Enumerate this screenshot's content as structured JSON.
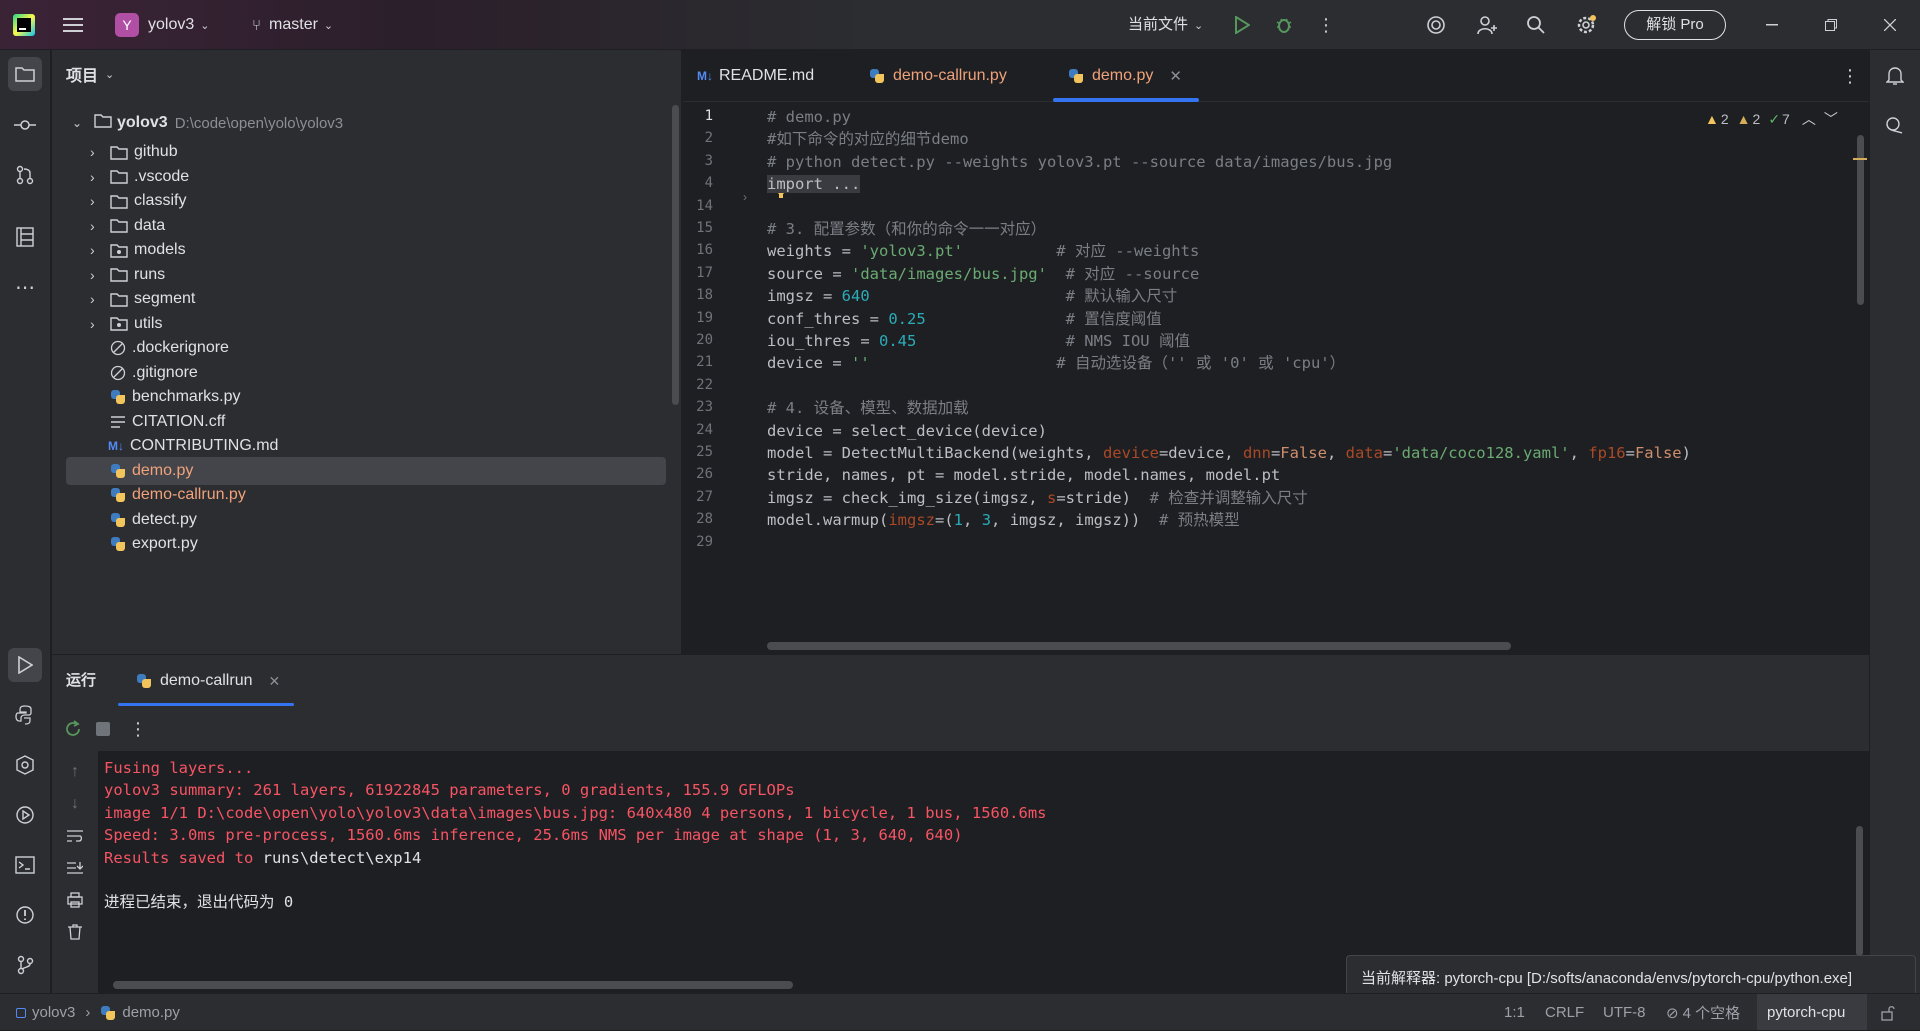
{
  "titlebar": {
    "project_badge": "Y",
    "project_name": "yolov3",
    "branch": "master",
    "run_config": "当前文件",
    "unlock_button": "解锁 Pro"
  },
  "project_panel": {
    "title": "项目",
    "root_name": "yolov3",
    "root_path": "D:\\code\\open\\yolo\\yolov3",
    "items": [
      {
        "label": "github",
        "type": "folder"
      },
      {
        "label": ".vscode",
        "type": "folder"
      },
      {
        "label": "classify",
        "type": "folder"
      },
      {
        "label": "data",
        "type": "folder"
      },
      {
        "label": "models",
        "type": "folder-pkg"
      },
      {
        "label": "runs",
        "type": "folder"
      },
      {
        "label": "segment",
        "type": "folder"
      },
      {
        "label": "utils",
        "type": "folder-pkg"
      },
      {
        "label": ".dockerignore",
        "type": "ignore"
      },
      {
        "label": ".gitignore",
        "type": "ignore"
      },
      {
        "label": "benchmarks.py",
        "type": "python"
      },
      {
        "label": "CITATION.cff",
        "type": "text"
      },
      {
        "label": "CONTRIBUTING.md",
        "type": "markdown"
      },
      {
        "label": "demo.py",
        "type": "python"
      },
      {
        "label": "demo-callrun.py",
        "type": "python"
      },
      {
        "label": "detect.py",
        "type": "python"
      },
      {
        "label": "export.py",
        "type": "python"
      }
    ]
  },
  "editor": {
    "tabs": [
      {
        "label": "README.md",
        "icon": "M↓"
      },
      {
        "label": "demo-callrun.py",
        "icon": "python"
      },
      {
        "label": "demo.py",
        "icon": "python",
        "active": true
      }
    ],
    "inspections": {
      "warn1": "2",
      "warn2": "2",
      "ok": "7"
    },
    "line_numbers": [
      "1",
      "2",
      "3",
      "4",
      "14",
      "15",
      "16",
      "17",
      "18",
      "19",
      "20",
      "21",
      "22",
      "23",
      "24",
      "25",
      "26",
      "27",
      "28",
      "29"
    ],
    "lines": [
      [
        {
          "c": "cm",
          "t": "# demo.py"
        }
      ],
      [
        {
          "c": "cm",
          "t": "#如下命令的对应的细节demo"
        }
      ],
      [
        {
          "c": "cm",
          "t": "# python detect.py --weights yolov3.pt --source data/images/bus.jpg"
        }
      ],
      [
        {
          "c": "tx",
          "t": "import ..."
        }
      ],
      [],
      [
        {
          "c": "cm",
          "t": "# 3. 配置参数（和你的命令一一对应）"
        }
      ],
      [
        {
          "c": "tx",
          "t": "weights = "
        },
        {
          "c": "st",
          "t": "'yolov3.pt'"
        },
        {
          "c": "cm",
          "t": "          # 对应 --weights"
        }
      ],
      [
        {
          "c": "tx",
          "t": "source = "
        },
        {
          "c": "st",
          "t": "'data/images/bus.jpg'"
        },
        {
          "c": "cm",
          "t": "  # 对应 --source"
        }
      ],
      [
        {
          "c": "tx",
          "t": "imgsz = "
        },
        {
          "c": "nm",
          "t": "640"
        },
        {
          "c": "cm",
          "t": "                     # 默认输入尺寸"
        }
      ],
      [
        {
          "c": "tx",
          "t": "conf_thres = "
        },
        {
          "c": "nm",
          "t": "0.25"
        },
        {
          "c": "cm",
          "t": "               # 置信度阈值"
        }
      ],
      [
        {
          "c": "tx",
          "t": "iou_thres = "
        },
        {
          "c": "nm",
          "t": "0.45"
        },
        {
          "c": "cm",
          "t": "                # NMS IOU 阈值"
        }
      ],
      [
        {
          "c": "tx",
          "t": "device = "
        },
        {
          "c": "st",
          "t": "''"
        },
        {
          "c": "cm",
          "t": "                    # 自动选设备（'' 或 '0' 或 'cpu'）"
        }
      ],
      [],
      [
        {
          "c": "cm",
          "t": "# 4. 设备、模型、数据加载"
        }
      ],
      [
        {
          "c": "tx",
          "t": "device = select_device(device)"
        }
      ],
      [
        {
          "c": "tx",
          "t": "model = DetectMultiBackend(weights, "
        },
        {
          "c": "pa",
          "t": "device"
        },
        {
          "c": "tx",
          "t": "=device, "
        },
        {
          "c": "pa",
          "t": "dnn"
        },
        {
          "c": "tx",
          "t": "="
        },
        {
          "c": "kw",
          "t": "False"
        },
        {
          "c": "tx",
          "t": ", "
        },
        {
          "c": "pa",
          "t": "data"
        },
        {
          "c": "tx",
          "t": "="
        },
        {
          "c": "st",
          "t": "'data/coco128.yaml'"
        },
        {
          "c": "tx",
          "t": ", "
        },
        {
          "c": "pa",
          "t": "fp16"
        },
        {
          "c": "tx",
          "t": "="
        },
        {
          "c": "kw",
          "t": "False"
        },
        {
          "c": "tx",
          "t": ")"
        }
      ],
      [
        {
          "c": "tx",
          "t": "stride, names, pt = model.stride, model.names, model.pt"
        }
      ],
      [
        {
          "c": "tx",
          "t": "imgsz = check_img_size(imgsz, "
        },
        {
          "c": "pa",
          "t": "s"
        },
        {
          "c": "tx",
          "t": "=stride)  "
        },
        {
          "c": "cm",
          "t": "# 检查并调整输入尺寸"
        }
      ],
      [
        {
          "c": "tx",
          "t": "model.warmup("
        },
        {
          "c": "pa",
          "t": "imgsz"
        },
        {
          "c": "tx",
          "t": "=("
        },
        {
          "c": "nm",
          "t": "1"
        },
        {
          "c": "tx",
          "t": ", "
        },
        {
          "c": "nm",
          "t": "3"
        },
        {
          "c": "tx",
          "t": ", imgsz, imgsz))  "
        },
        {
          "c": "cm",
          "t": "# 预热模型"
        }
      ],
      []
    ]
  },
  "run_panel": {
    "title": "运行",
    "tab": "demo-callrun",
    "output": [
      {
        "c": "err",
        "t": "Fusing layers..."
      },
      {
        "c": "err",
        "t": "yolov3 summary: 261 layers, 61922845 parameters, 0 gradients, 155.9 GFLOPs"
      },
      {
        "c": "err",
        "t": "image 1/1 D:\\code\\open\\yolo\\yolov3\\data\\images\\bus.jpg: 640x480 4 persons, 1 bicycle, 1 bus, 1560.6ms"
      },
      {
        "c": "err",
        "t": "Speed: 3.0ms pre-process, 1560.6ms inference, 25.6ms NMS per image at shape (1, 3, 640, 640)"
      },
      {
        "c": "mix",
        "t": "Results saved to ",
        "b": "runs\\detect\\exp14"
      },
      {
        "c": "blank",
        "t": ""
      },
      {
        "c": "norm",
        "t": "进程已结束，退出代码为 0"
      }
    ]
  },
  "statusbar": {
    "breadcrumb_project": "yolov3",
    "breadcrumb_file": "demo.py",
    "position": "1:1",
    "line_sep": "CRLF",
    "encoding": "UTF-8",
    "indent": "4 个空格",
    "interpreter": "pytorch-cpu"
  },
  "tooltip": "当前解释器: pytorch-cpu [D:/softs/anaconda/envs/pytorch-cpu/python.exe]",
  "colors": {
    "error_text": "#f75464",
    "accent": "#3574f0",
    "selection": "#43454a"
  }
}
